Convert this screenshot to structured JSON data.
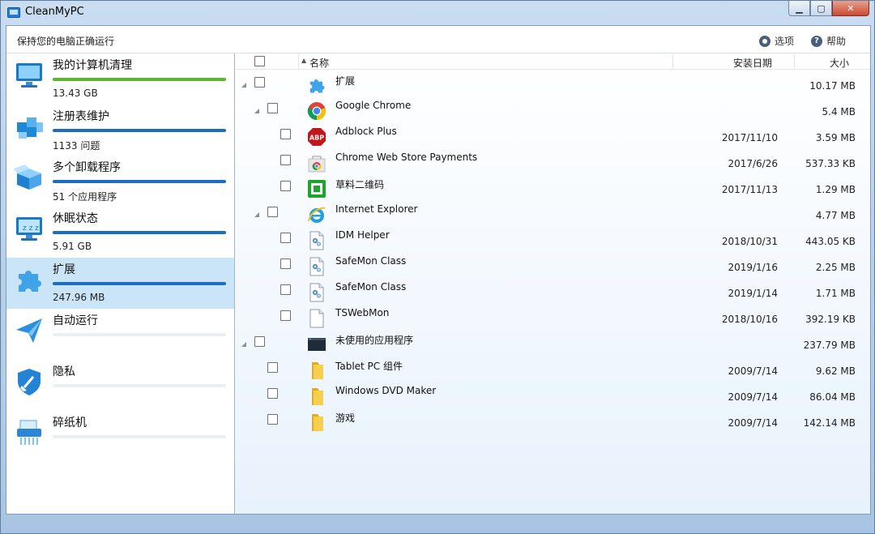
{
  "window": {
    "title": "CleanMyPC"
  },
  "header": {
    "subtitle": "保持您的电脑正确运行",
    "options_label": "选项",
    "help_label": "帮助"
  },
  "sidebar": {
    "items": [
      {
        "label": "我的计算机清理",
        "sub": "13.43 GB",
        "icon": "monitor-icon",
        "progress": 1.0,
        "bar_color": "#5cb531"
      },
      {
        "label": "注册表维护",
        "sub": "1133 问题",
        "icon": "registry-blocks-icon",
        "progress": 1.0,
        "bar_color": "#1b6ec2"
      },
      {
        "label": "多个卸载程序",
        "sub": "51 个应用程序",
        "icon": "box-icon",
        "progress": 1.0,
        "bar_color": "#1b6ec2"
      },
      {
        "label": "休眠状态",
        "sub": "5.91 GB",
        "icon": "sleep-monitor-icon",
        "progress": 1.0,
        "bar_color": "#1b6ec2"
      },
      {
        "label": "扩展",
        "sub": "247.96 MB",
        "icon": "puzzle-icon",
        "progress": 1.0,
        "bar_color": "#1b6ec2",
        "active": true
      },
      {
        "label": "自动运行",
        "sub": "",
        "icon": "paper-plane-icon",
        "progress": 0,
        "bar_color": "#1b6ec2"
      },
      {
        "label": "隐私",
        "sub": "",
        "icon": "shield-broom-icon",
        "progress": 0,
        "bar_color": "#1b6ec2"
      },
      {
        "label": "碎纸机",
        "sub": "",
        "icon": "shredder-icon",
        "progress": 0,
        "bar_color": "#1b6ec2"
      }
    ]
  },
  "table": {
    "columns": {
      "name": "名称",
      "date": "安装日期",
      "size": "大小"
    },
    "rows": [
      {
        "name": "扩展",
        "date": "",
        "size": "10.17 MB",
        "level": 0,
        "expandable": true,
        "icon": "puzzle-icon"
      },
      {
        "name": "Google Chrome",
        "date": "",
        "size": "5.4 MB",
        "level": 1,
        "expandable": true,
        "icon": "chrome-icon"
      },
      {
        "name": "Adblock Plus",
        "date": "2017/11/10",
        "size": "3.59 MB",
        "level": 2,
        "expandable": false,
        "icon": "adblock-icon"
      },
      {
        "name": "Chrome Web Store Payments",
        "date": "2017/6/26",
        "size": "537.33 KB",
        "level": 2,
        "expandable": false,
        "icon": "chrome-webstore-icon"
      },
      {
        "name": "草料二维码",
        "date": "2017/11/13",
        "size": "1.29 MB",
        "level": 2,
        "expandable": false,
        "icon": "qr-extension-icon"
      },
      {
        "name": "Internet Explorer",
        "date": "",
        "size": "4.77 MB",
        "level": 1,
        "expandable": true,
        "icon": "ie-icon"
      },
      {
        "name": "IDM Helper",
        "date": "2018/10/31",
        "size": "443.05 KB",
        "level": 2,
        "expandable": false,
        "icon": "dll-file-icon"
      },
      {
        "name": "SafeMon Class",
        "date": "2019/1/16",
        "size": "2.25 MB",
        "level": 2,
        "expandable": false,
        "icon": "dll-file-icon"
      },
      {
        "name": "SafeMon Class",
        "date": "2019/1/14",
        "size": "1.71 MB",
        "level": 2,
        "expandable": false,
        "icon": "dll-file-icon"
      },
      {
        "name": "TSWebMon",
        "date": "2018/10/16",
        "size": "392.19 KB",
        "level": 2,
        "expandable": false,
        "icon": "blank-file-icon"
      },
      {
        "name": "未使用的应用程序",
        "date": "",
        "size": "237.79 MB",
        "level": 0,
        "expandable": true,
        "icon": "app-window-icon"
      },
      {
        "name": "Tablet PC 组件",
        "date": "2009/7/14",
        "size": "9.62 MB",
        "level": 1,
        "expandable": false,
        "icon": "folder-icon"
      },
      {
        "name": "Windows DVD Maker",
        "date": "2009/7/14",
        "size": "86.04 MB",
        "level": 1,
        "expandable": false,
        "icon": "folder-icon"
      },
      {
        "name": "游戏",
        "date": "2009/7/14",
        "size": "142.14 MB",
        "level": 1,
        "expandable": false,
        "icon": "folder-icon"
      }
    ]
  }
}
